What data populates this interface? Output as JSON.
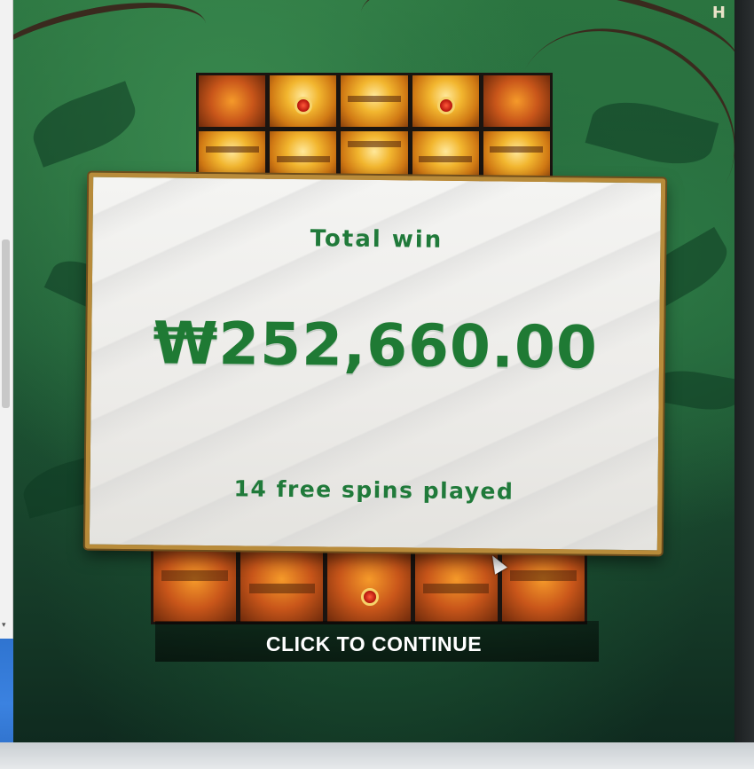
{
  "game": {
    "corner_logo": "H"
  },
  "win_panel": {
    "title": "Total win",
    "amount": "₩252,660.00",
    "subtitle": "14 free spins played"
  },
  "continue_label": "CLICK TO CONTINUE",
  "colors": {
    "win_text": "#1f7a34",
    "panel_frame": "#b88b3a",
    "jungle_green": "#2b7440",
    "taskbar_blue": "#2f74d0"
  },
  "icons": [
    "mouse-cursor-icon",
    "scroll-thumb",
    "scroll-down-arrow-icon"
  ]
}
